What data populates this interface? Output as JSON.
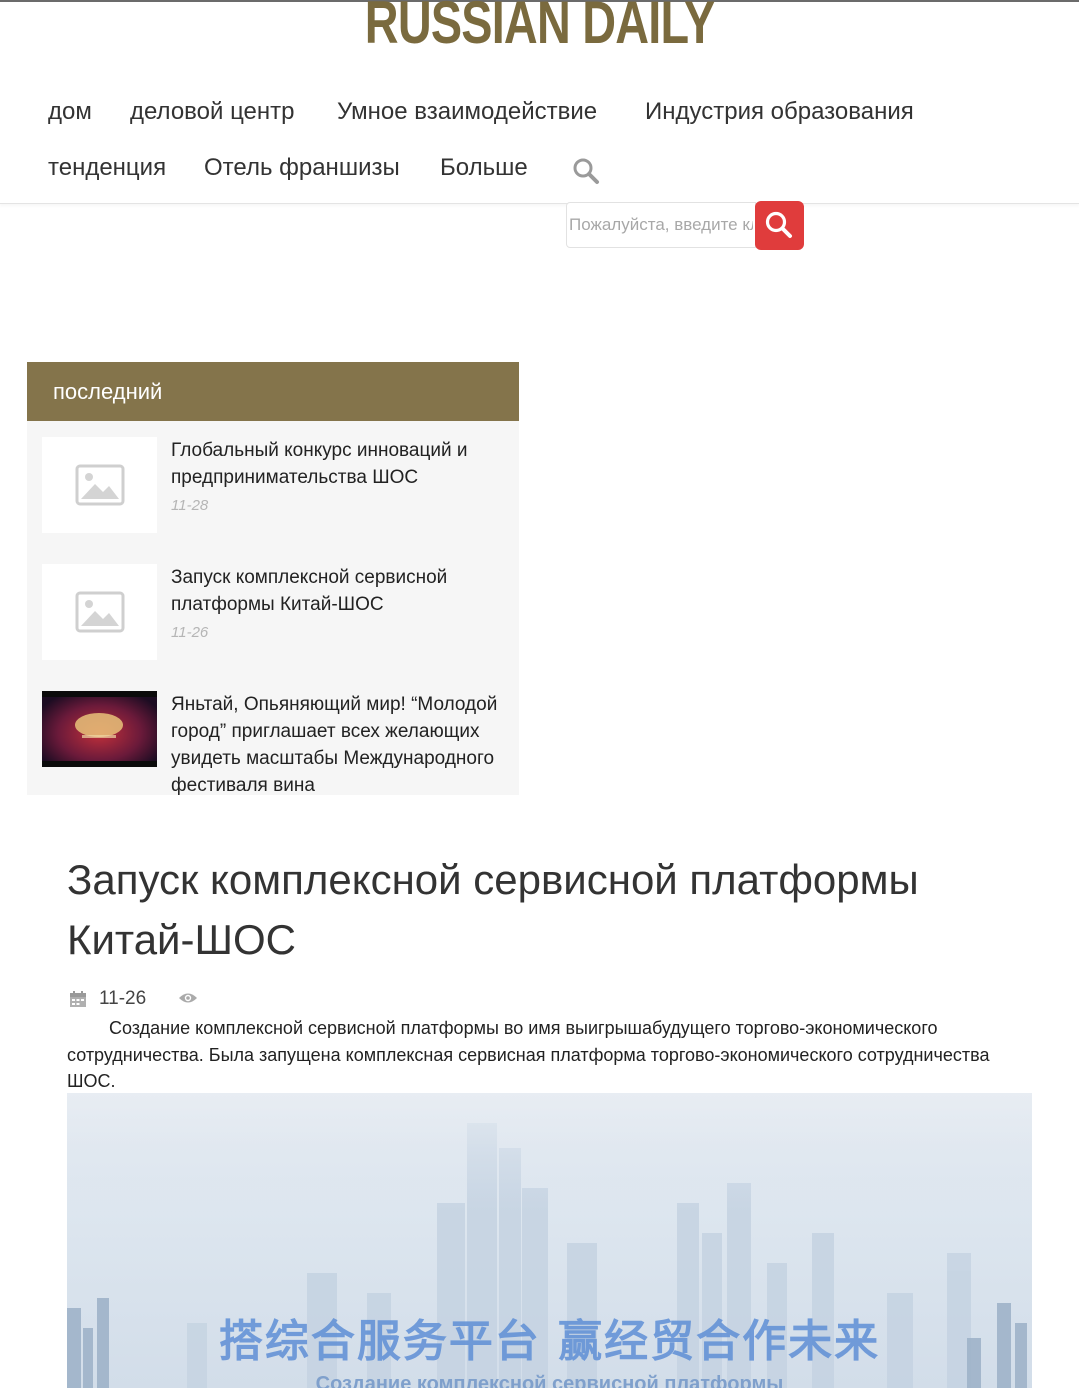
{
  "site": {
    "logo": "RUSSIAN DAILY"
  },
  "nav": {
    "items": [
      "дом",
      "деловой центр",
      "Умное взаимодействие",
      "Индустрия образования",
      "тенденция",
      "Отель франшизы",
      "Больше"
    ]
  },
  "search": {
    "placeholder": "Пожалуйста, введите ключевые слова"
  },
  "sidebar": {
    "heading": "последний",
    "items": [
      {
        "title": "Глобальный конкурс инноваций и предпринимательства ШОС",
        "date": "11-28",
        "thumb": "image-placeholder-icon"
      },
      {
        "title": "Запуск комплексной сервисной платформы Китай-ШОС",
        "date": "11-26",
        "thumb": "image-placeholder-icon"
      },
      {
        "title": "Яньтай, Опьяняющий мир! “Молодой город” приглашает всех желающих увидеть масштабы Международного фестиваля вина",
        "thumb": "video-thumbnail"
      }
    ]
  },
  "article": {
    "title": "Запуск комплексной сервисной платформы Китай-ШОС",
    "date": "11-26",
    "body": "Создание комплексной сервисной платформы во имя выигрышабудущего торгово-экономического сотрудничества. Была запущена комплексная сервисная платформа торгово-экономического сотрудничества ШОС.",
    "hero_caption": "搭综合服务平台 赢经贸合作未来",
    "hero_subcaption": "Создание комплексной сервисной платформы"
  },
  "colors": {
    "accent": "#84744b",
    "search_button": "#e03c3c",
    "logo": "#7a6a3e"
  }
}
